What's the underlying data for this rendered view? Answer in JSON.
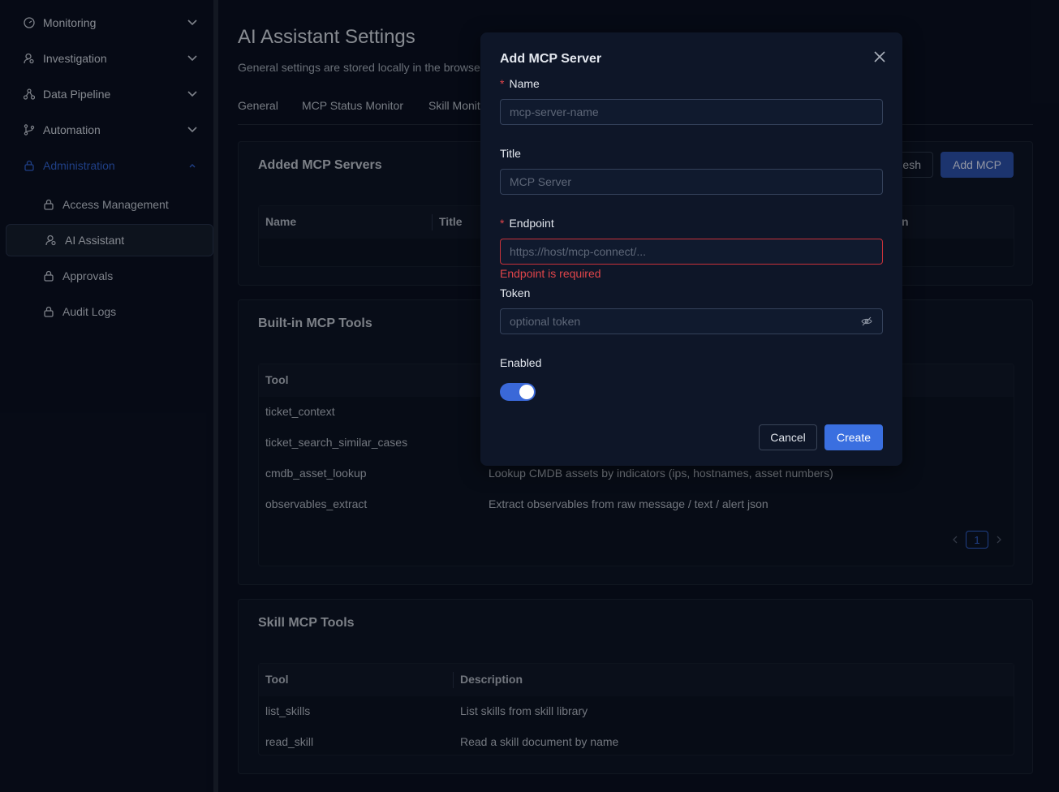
{
  "sidebar": {
    "items": [
      {
        "label": "Monitoring",
        "icon": "dashboard-icon",
        "expanded": false
      },
      {
        "label": "Investigation",
        "icon": "user-search-icon",
        "expanded": false
      },
      {
        "label": "Data Pipeline",
        "icon": "pipeline-icon",
        "expanded": false
      },
      {
        "label": "Automation",
        "icon": "branch-icon",
        "expanded": false
      },
      {
        "label": "Administration",
        "icon": "lock-icon",
        "expanded": true
      }
    ],
    "sub_items": [
      {
        "label": "Access Management",
        "icon": "lock-icon"
      },
      {
        "label": "AI Assistant",
        "icon": "user-search-icon",
        "selected": true
      },
      {
        "label": "Approvals",
        "icon": "lock-icon"
      },
      {
        "label": "Audit Logs",
        "icon": "lock-icon"
      }
    ]
  },
  "page": {
    "title": "AI Assistant Settings",
    "description": "General settings are stored locally in the browser"
  },
  "tabs": [
    "General",
    "MCP Status Monitor",
    "Skill Monit"
  ],
  "added_servers": {
    "title": "Added MCP Servers",
    "refresh_label": "esh",
    "add_label": "Add MCP",
    "columns": [
      "Name",
      "Title",
      "n"
    ]
  },
  "builtin_tools": {
    "title": "Built-in MCP Tools",
    "columns": [
      "Tool"
    ],
    "rows": [
      {
        "tool": "ticket_context",
        "description": ""
      },
      {
        "tool": "ticket_search_similar_cases",
        "description": ""
      },
      {
        "tool": "cmdb_asset_lookup",
        "description": "Lookup CMDB assets by indicators (ips, hostnames, asset numbers)"
      },
      {
        "tool": "observables_extract",
        "description": "Extract observables from raw message / text / alert json"
      }
    ],
    "page": "1"
  },
  "skill_tools": {
    "title": "Skill MCP Tools",
    "columns": [
      "Tool",
      "Description"
    ],
    "rows": [
      {
        "tool": "list_skills",
        "description": "List skills from skill library"
      },
      {
        "tool": "read_skill",
        "description": "Read a skill document by name"
      }
    ]
  },
  "modal": {
    "title": "Add MCP Server",
    "required_mark": "*",
    "name": {
      "label": "Name",
      "placeholder": "mcp-server-name",
      "value": ""
    },
    "title_field": {
      "label": "Title",
      "placeholder": "MCP Server",
      "value": ""
    },
    "endpoint": {
      "label": "Endpoint",
      "placeholder": "https://host/mcp-connect/...",
      "value": "",
      "error": "Endpoint is required"
    },
    "token": {
      "label": "Token",
      "placeholder": "optional token",
      "value": ""
    },
    "enabled": {
      "label": "Enabled",
      "value": true
    },
    "cancel_label": "Cancel",
    "create_label": "Create"
  },
  "colors": {
    "accent": "#3a68d8",
    "error": "#e0454a",
    "background": "#0a1020"
  }
}
